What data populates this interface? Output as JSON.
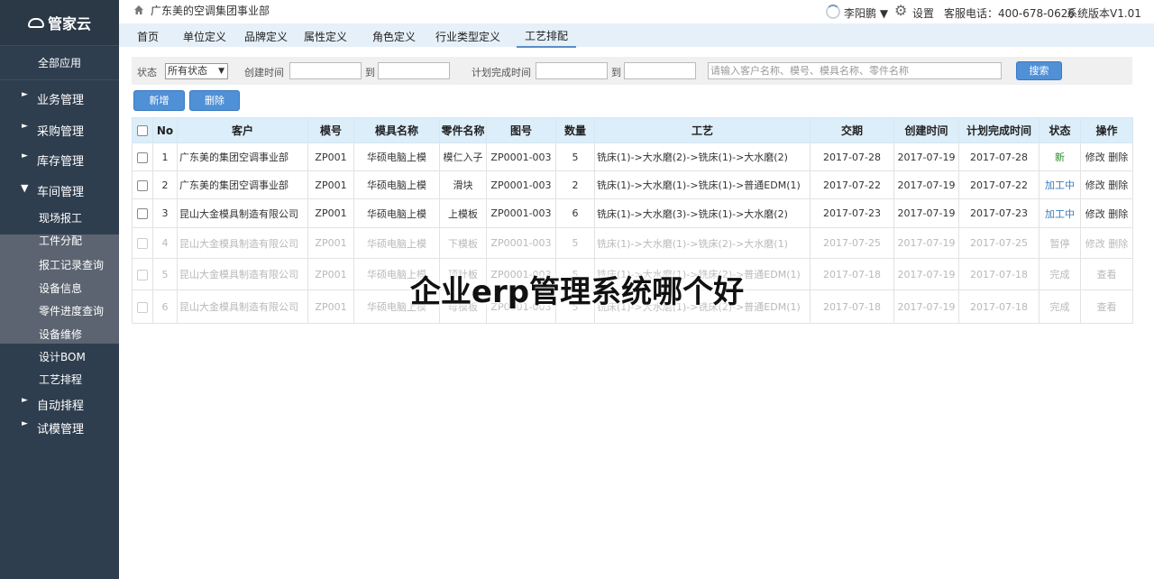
{
  "app": {
    "logo_text": "管家云",
    "all_apps": "全部应用"
  },
  "sidebar": {
    "groups": [
      {
        "label": "业务管理",
        "expanded": false
      },
      {
        "label": "采购管理",
        "expanded": false
      },
      {
        "label": "库存管理",
        "expanded": false
      },
      {
        "label": "车间管理",
        "expanded": true
      },
      {
        "label": "自动排程",
        "expanded": false
      },
      {
        "label": "试模管理",
        "expanded": false
      }
    ],
    "sub_items": [
      "现场报工",
      "工件分配",
      "报工记录查询",
      "设备信息",
      "零件进度查询",
      "设备维修",
      "设计BOM",
      "工艺排程"
    ]
  },
  "header": {
    "breadcrumb": "广东美的空调集团事业部",
    "user": "李阳鹏 ▼",
    "settings": "设置",
    "phone": "客服电话：400-678-0626",
    "version": "系统版本V1.01"
  },
  "tabs": [
    "首页",
    "单位定义",
    "品牌定义",
    "属性定义",
    "角色定义",
    "行业类型定义",
    "工艺排配"
  ],
  "active_tab": "工艺排配",
  "filter": {
    "status_label": "状态",
    "status_value": "所有状态",
    "created_label": "创建时间",
    "to_label": "到",
    "plan_label": "计划完成时间",
    "search_placeholder": "请输入客户名称、模号、模具名称、零件名称",
    "search_button": "搜索"
  },
  "actions": {
    "add": "新增",
    "delete": "删除"
  },
  "table": {
    "headers": [
      "No",
      "客户",
      "模号",
      "模具名称",
      "零件名称",
      "图号",
      "数量",
      "工艺",
      "交期",
      "创建时间",
      "计划完成时间",
      "状态",
      "操作"
    ],
    "rows": [
      {
        "no": "1",
        "customer": "广东美的集团空调事业部",
        "mold_no": "ZP001",
        "mold_name": "华硕电脑上模",
        "part": "模仁入子",
        "drawing": "ZP0001-003",
        "qty": "5",
        "process": "铣床(1)->大水磨(2)->铣床(1)->大水磨(2)",
        "due": "2017-07-28",
        "created": "2017-07-19",
        "planned": "2017-07-28",
        "status": "新",
        "status_type": "new",
        "ops": "修改 删除",
        "faded": false
      },
      {
        "no": "2",
        "customer": "广东美的集团空调事业部",
        "mold_no": "ZP001",
        "mold_name": "华硕电脑上模",
        "part": "滑块",
        "drawing": "ZP0001-003",
        "qty": "2",
        "process": "铣床(1)->大水磨(1)->铣床(1)->普通EDM(1)",
        "due": "2017-07-22",
        "created": "2017-07-19",
        "planned": "2017-07-22",
        "status": "加工中",
        "status_type": "proc",
        "ops": "修改 删除",
        "faded": false
      },
      {
        "no": "3",
        "customer": "昆山大金模具制造有限公司",
        "mold_no": "ZP001",
        "mold_name": "华硕电脑上模",
        "part": "上模板",
        "drawing": "ZP0001-003",
        "qty": "6",
        "process": "铣床(1)->大水磨(3)->铣床(1)->大水磨(2)",
        "due": "2017-07-23",
        "created": "2017-07-19",
        "planned": "2017-07-23",
        "status": "加工中",
        "status_type": "proc",
        "ops": "修改 删除",
        "faded": false
      },
      {
        "no": "4",
        "customer": "昆山大金模具制造有限公司",
        "mold_no": "ZP001",
        "mold_name": "华硕电脑上模",
        "part": "下模板",
        "drawing": "ZP0001-003",
        "qty": "5",
        "process": "铣床(1)->大水磨(1)->铣床(2)->大水磨(1)",
        "due": "2017-07-25",
        "created": "2017-07-19",
        "planned": "2017-07-25",
        "status": "暂停",
        "status_type": "other",
        "ops": "修改 删除",
        "faded": true
      },
      {
        "no": "5",
        "customer": "昆山大金模具制造有限公司",
        "mold_no": "ZP001",
        "mold_name": "华硕电脑上模",
        "part": "顶针板",
        "drawing": "ZP0001-003",
        "qty": "5",
        "process": "铣床(1)->大水磨(1)->铣床(2)->普通EDM(1)",
        "due": "2017-07-18",
        "created": "2017-07-19",
        "planned": "2017-07-18",
        "status": "完成",
        "status_type": "other",
        "ops": "查看",
        "faded": true
      },
      {
        "no": "6",
        "customer": "昆山大金模具制造有限公司",
        "mold_no": "ZP001",
        "mold_name": "华硕电脑上模",
        "part": "母模板",
        "drawing": "ZP0001-003",
        "qty": "5",
        "process": "铣床(1)->大水磨(1)->铣床(2)->普通EDM(1)",
        "due": "2017-07-18",
        "created": "2017-07-19",
        "planned": "2017-07-18",
        "status": "完成",
        "status_type": "other",
        "ops": "查看",
        "faded": true
      }
    ]
  },
  "overlay_text": "企业erp管理系统哪个好"
}
